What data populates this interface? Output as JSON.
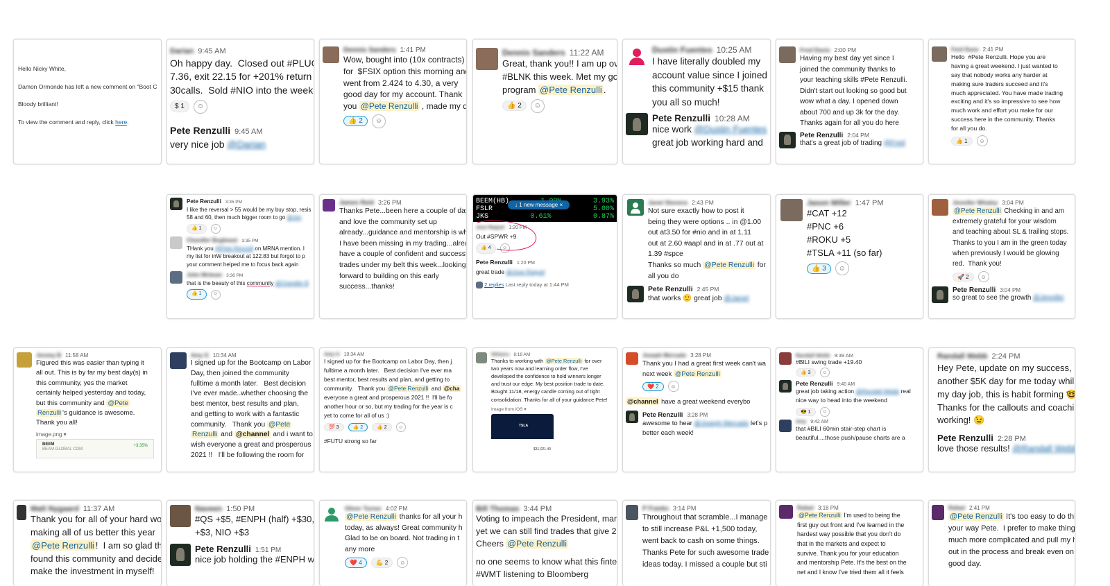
{
  "cards": {
    "c11": {
      "line1": "Hello Nicky White,",
      "line2": "Damon Ormonde has left a new comment on \"Boot C",
      "line3": "Bloody brilliant!",
      "line4": "To view the comment and reply, click ",
      "link": "here",
      "dot": "."
    },
    "c12": {
      "name": "Darian",
      "time": "9:45 AM",
      "text": "Oh happy day.  Closed out #PLUG ca\n7.36, exit 22.15 for +201% return on\n30calls.  Sold #NIO into the weekend",
      "react1": "$ 1",
      "rname": "Pete Renzulli",
      "rtime": "9:45 AM",
      "rtext": "very nice job ",
      "rmention": "@Darian"
    },
    "c13": {
      "name": "Dennis Sanders",
      "time": "1:41 PM",
      "text": "Wow, bought into (10x contracts)\nfor  $FSIX option this morning and\nwent from 2.424 to 4.30, a very\ngood day for my account. Thank\nyou ",
      "mention": "@Pete Renzulli",
      "text2": " , made my day",
      "react1": "👍 2"
    },
    "c14": {
      "name": "Dennis Sanders",
      "time": "11:22 AM",
      "text": "Great, thank you!! I am up over\n#BLNK this week. Met my goal\nprogram ",
      "mention": "@Pete Renzulli",
      "text2": ".",
      "react1": "👍 2"
    },
    "c15": {
      "name": "Dustin Fuentes",
      "time": "10:25 AM",
      "text": "I have literally doubled my\naccount value since I joined\nthis community +$15 thank\nyou all so much!",
      "rname": "Pete Renzulli",
      "rtime": "10:28 AM",
      "rtext": "nice work ",
      "rmention": "@Dustin Fuentes",
      "rtext2": "great job working hard and"
    },
    "c16": {
      "name": "Fred Davis",
      "time": "2:00 PM",
      "text": "Having my best day yet since I\njoined the community thanks to\nyour teaching skills #Pete Renzulli.\nDidn't start out looking so good but\nwow what a day. I opened down\nabout 700 and up 3k for the day.\nThanks again for all you do here",
      "rname": "Pete Renzulli",
      "rtime": "2:04 PM",
      "rtext": "that's a great job of trading ",
      "rmention": "@Fred"
    },
    "c17": {
      "name": "Ferd Suno",
      "time": "2:41 PM",
      "text": "Hello  #Pete Renzulli. Hope you are\nhaving a great weekend. I just wanted to\nsay that nobody works any harder at\nmaking sure traders succeed and it's\nmuch appreciated. You have made trading\nexciting and it's so impressive to see how\nmuch work and effort you make for our\nsuccess here in the community. Thanks\nfor all you do.",
      "react1": "👍 1"
    },
    "c22": {
      "n1": "Pete Renzulli",
      "t1": "3:35 PM",
      "x1": "I like the reversal > 55 would be my buy stop, resis\n58 and 60, then much bigger room to go ",
      "m1": "@Jon",
      "r1": "👍 1",
      "n2": "Chandler Bugbeast",
      "t2": "3:35 PM",
      "x2a": "THank you ",
      "m2": "@Pete Renzulli",
      "x2b": " on MRNA mention. I\nmy list for inW breakout at 122.83 but forgot to p\nyour comment helped me to focus back again",
      "n3": "John Mcbean",
      "t3": "3:36 PM",
      "x3a": "that is the beauty of this ",
      "x3b": "community",
      "m3": "@Chandler B",
      "r3": "👍 1"
    },
    "c23": {
      "name": "James Reid",
      "time": "3:26 PM",
      "text": "Thanks Pete...been here a couple of days\nand love the community set up\nalready...guidance and mentorship is wh\nI have been missing in my trading...alrea\nhave a couple of confident and successf\ntrades under my belt this week...looking\nforward to building on this early\nsuccess...thanks!"
    },
    "c24": {
      "r1a": "BEEM(HB)",
      "r1b": "1.09%",
      "r1c": "3.93%",
      "banner": "↓  1 new message   ×",
      "r2a": "FSLR",
      "r2b": "",
      "r2c": "5.00%",
      "r3a": "JKS",
      "r3b": "0.61%",
      "r3c": "0.87%",
      "name": "Jose Raquel",
      "time": "1:20 PM",
      "text": "Out #SPWR  +9",
      "react1": "👍 4",
      "rname": "Pete Renzulli",
      "rtime": "1:20 PM",
      "rtext": "great trade ",
      "rmention": "@Jose Raquel",
      "replies": "2 replies",
      "last": "Last reply today at 1:44 PM"
    },
    "c25": {
      "name": "Janet Stevens",
      "time": "2:43 PM",
      "text": "Not sure exactly how to post it\nbeing they were options .. in @1.00\nout at3.50 for #nio and in at 1.11\nout at 2.60 #aapl and in at .77 out at\n1.39 #spce\nThanks so much ",
      "mention": "@Pete Renzulli",
      "text2": " for\nall you do",
      "rname": "Pete Renzulli",
      "rtime": "2:45 PM",
      "rtext": "that works 🙂 great job ",
      "rmention": "@Janet"
    },
    "c26": {
      "name": "Jason Miller",
      "time": "1:47 PM",
      "text": "#CAT +12\n#PNC +6\n#ROKU +5\n#TSLA +11 (so far)",
      "react1": "👍 3"
    },
    "c27": {
      "name": "Jennifer Whaley",
      "time": "3:04 PM",
      "mention": "@Pete Renzulli",
      "text": " Checking in and am\nextremely grateful for your wisdom\nand teaching about SL & trailing stops.\nThanks to you I am in the green today\nwhen previously I would be glowing\nred.  Thank you!",
      "react1": "🚀 2",
      "rname": "Pete Renzulli",
      "rtime": "3:04 PM",
      "rtext": "so great to see the growth ",
      "rmention": "@Jennifer"
    },
    "c31": {
      "name": "Jeremy B",
      "time": "11:58 AM",
      "text": "Figured this was easier than typing it\nall out. This is by far my best day(s) in\nthis community, yes the market\ncertainly helped yesterday and today,\nbut this community and ",
      "mention": "@Pete",
      "mention2": "Renzulli",
      "text2": "'s guidance is awesome.\nThank you all!",
      "img": "image.png ▾",
      "imgtitle": "BEEM",
      "imgsub": "BEAM GLOBAL COM",
      "imgval": "+3.35%"
    },
    "c32": {
      "name": "Amy G",
      "time": "10:34 AM",
      "text": "I signed up for the Bootcamp on Labor\nDay, then joined the community\nfulltime a month later.   Best decision\nI've ever made..whether choosing the\nbest mentor, best results and plan,\nand getting to work with a fantastic\ncommunity.   Thank you ",
      "mention": "@Pete",
      "mention2": "Renzulli",
      "text2": " and ",
      "mention3": "@channel",
      "text3": " and i want to\nwish everyone a great and prosperous\n2021 !!   I'll be following the room for"
    },
    "c33": {
      "name": "Amy G",
      "time": "10:34 AM",
      "text": "I signed up for the Bootcamp on Labor Day, then j\nfulltime a month later.   Best decision I've ever ma\nbest mentor, best results and plan, and getting to\ncommunity.   Thank you ",
      "mention": "@Pete Renzulli",
      "text2": " and ",
      "mention3": "@cha",
      "text3": "\neveryone a great and prosperous 2021 !!  I'll be fo\nanother hour or so, but my trading for the year is c\nyet to come for all of us :)",
      "react1": "💯 3",
      "react2": "👍 2",
      "react3": "👍 2",
      "extra": "#FUTU strong so far"
    },
    "c34": {
      "name": "Williams",
      "time": "8:18 AM",
      "text": "Thanks to working with ",
      "mention": "@Pete Renzulli",
      "text2": " for over\ntwo years now and learning order flow, I've\ndeveloped the confidence to hold winners longer\nand trust our edge. My best position trade to date.\nBought 11/18, energy candle coming out of tight\nconsolidation. Thanks for all of your guidance Pete!",
      "img": "Image from iOS ▾",
      "ticker": "TSLA",
      "val": "$31,021.40"
    },
    "c35": {
      "name": "Joseph Mercado",
      "time": "3:28 PM",
      "text": "Thank you I had a great first week can't wa\nnext week ",
      "mention": "@Pete Renzulli",
      "react1": "❤️ 2",
      "mention2": "@channel",
      "text2": " have a great weekend everybo",
      "rname": "Pete Renzulli",
      "rtime": "3:28 PM",
      "rtext": "awesome to hear ",
      "rmention": "@Joseph Mercado",
      "rtext2": " let's p\nbetter each week!"
    },
    "c36": {
      "name": "Randall Webb",
      "time": "9:39 AM",
      "text": "#BILI swing trade +19.40",
      "react1": "👍 3",
      "rname": "Pete Renzulli",
      "rtime": "9:40 AM",
      "rtext": "great job taking action ",
      "rmention": "@Randall Webb",
      "rtext2": " real\nnice way to head into the weekend",
      "react2": "😎 1",
      "n3": "Amy",
      "t3": "9:42 AM",
      "x3": "that #BILI 60min stair-step chart is\nbeautiful....those push/pause charts are a"
    },
    "c37": {
      "name": "Randall Webb",
      "time": "2:24 PM",
      "text": "Hey Pete, update on my success,\nanother $5K day for me today whil\nmy day job, this is habit forming 🤓\nThanks for the callouts and coachin\nworking! 😉",
      "rname": "Pete Renzulli",
      "rtime": "2:28 PM",
      "rtext": "love those results! ",
      "rmention": "@Randall Webb"
    },
    "c41": {
      "name": "Matt Nygaard",
      "time": "11:37 AM",
      "text": "Thank you for all of your hard wo\nmaking all of us better this year\n",
      "mention": "@Pete Renzulli",
      "text2": "!  I am so glad tha\nfound this community and decide\nmake the investment in myself!"
    },
    "c42": {
      "name": "Naveen",
      "time": "1:50 PM",
      "text": "#QS +$5, #ENPH (half) +$30,\n+$3, NIO +$3",
      "rname": "Pete Renzulli",
      "rtime": "1:51 PM",
      "rtext": "nice job holding the #ENPH w"
    },
    "c43": {
      "name": "Oliver Turner",
      "time": "4:02 PM",
      "mention": "@Pete Renzulli",
      "text": " thanks for all your h\ntoday, as always! Great community h\nGlad to be on board. Not trading in t\nany more",
      "react1": "❤️ 4",
      "react2": "💪 2"
    },
    "c44": {
      "name": "Bill Thomas",
      "time": "3:44 PM",
      "text": "Voting to impeach the President, mark\nyet we can still find trades that give 20\nCheers ",
      "mention": "@Pete Renzulli",
      "text2": "no one seems to know what this fintec\n#WMT listening to Bloomberg"
    },
    "c45": {
      "name": "P Franks",
      "time": "3:14 PM",
      "text": "Throughout that scramble...I manage\nto still increase P&L +1,500 today,\nwent back to cash on some things.\nThanks Pete for such awesome trade\nideas today. I missed a couple but sti"
    },
    "c46": {
      "name": "Rafael",
      "time": "3:18 PM",
      "mention": "@Pete Renzulli",
      "text": " I'm used to being the\nfirst guy out front and I've learned in the\nhardest way possible that you don't do\nthat in the markets and expect to\nsurvive. Thank you for your education\nand mentorship Pete. It's the best on the\nnet and I know I've tried them all it feels"
    },
    "c47": {
      "name": "Rafael",
      "time": "2:41 PM",
      "mention": "@Pete Renzulli",
      "text": " It's too easy to do thi\nyour way Pete.  I prefer to make thing\nmuch more complicated and pull my h\nout in the process and break even on\ngood day."
    }
  },
  "colors": {
    "mention_bg": "#fdf1c8",
    "link": "#1264a3",
    "react_active": "#1d9bd1"
  }
}
